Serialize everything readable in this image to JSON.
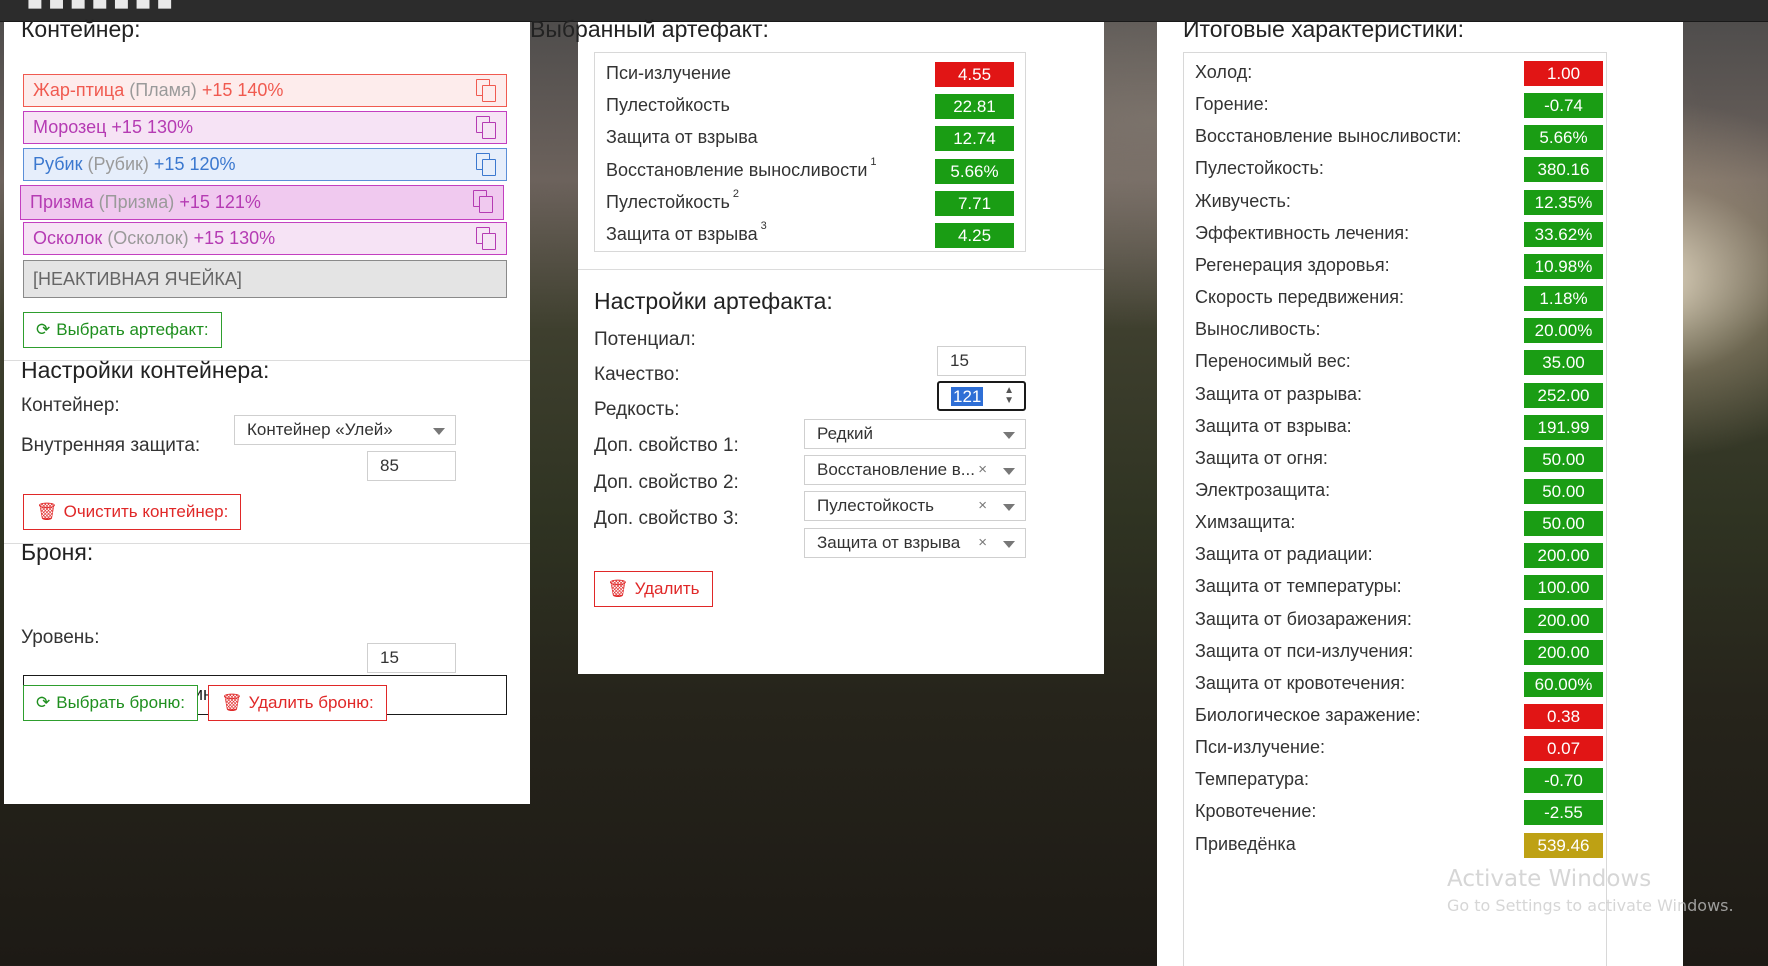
{
  "left": {
    "container_title": "Контейнер:",
    "slots": [
      {
        "name": "Жар-птица",
        "alt": "(Пламя)",
        "stat": "+15 140%",
        "color": "#f05a50",
        "border": "#f05a50",
        "bg": "#fdecec"
      },
      {
        "name": "Морозец",
        "alt": "",
        "stat": "+15 130%",
        "color": "#b53bb3",
        "border": "#c33fc0",
        "bg": "#f6e3f5"
      },
      {
        "name": "Рубик",
        "alt": "(Рубик)",
        "stat": "+15 120%",
        "color": "#3b78cf",
        "border": "#5b8fd8",
        "bg": "#e6eefb"
      },
      {
        "name": "Призма",
        "alt": "(Призма)",
        "stat": "+15 121%",
        "color": "#b53bb3",
        "border": "#c33fc0",
        "bg": "#f0c9ef"
      },
      {
        "name": "Осколок",
        "alt": "(Осколок)",
        "stat": "+15 130%",
        "color": "#b53bb3",
        "border": "#c33fc0",
        "bg": "#f6e3f5"
      }
    ],
    "inactive_slot": "[НЕАКТИВНАЯ ЯЧЕЙКА]",
    "choose_artifact_btn": "Выбрать артефакт:",
    "container_settings_title": "Настройки контейнера:",
    "container_label": "Контейнер:",
    "container_value": "Контейнер «Улей»",
    "inner_protection_label": "Внутренняя защита:",
    "inner_protection_value": "85",
    "clear_container_btn": "Очистить контейнер:",
    "armor_title": "Броня:",
    "armor_value": "Бронекостюм «Ронин»",
    "level_label": "Уровень:",
    "level_value": "15",
    "choose_armor_btn": "Выбрать броню:",
    "delete_armor_btn": "Удалить броню:"
  },
  "middle": {
    "selected_title": "Выбранный артефакт:",
    "stats": [
      {
        "name": "Пси-излучение",
        "sup": "",
        "value": "4.55",
        "type": "red"
      },
      {
        "name": "Пулестойкость",
        "sup": "",
        "value": "22.81",
        "type": "green"
      },
      {
        "name": "Защита от взрыва",
        "sup": "",
        "value": "12.74",
        "type": "green"
      },
      {
        "name": "Восстановление выносливости",
        "sup": "1",
        "value": "5.66%",
        "type": "green"
      },
      {
        "name": "Пулестойкость",
        "sup": "2",
        "value": "7.71",
        "type": "green"
      },
      {
        "name": "Защита от взрыва",
        "sup": "3",
        "value": "4.25",
        "type": "green"
      }
    ],
    "settings_title": "Настройки артефакта:",
    "potential_label": "Потенциал:",
    "potential_value": "15",
    "quality_label": "Качество:",
    "quality_value": "121",
    "rarity_label": "Редкость:",
    "rarity_value": "Редкий",
    "extra1_label": "Доп. свойство 1:",
    "extra1_value": "Восстановление в...",
    "extra2_label": "Доп. свойство 2:",
    "extra2_value": "Пулестойкость",
    "extra3_label": "Доп. свойство 3:",
    "extra3_value": "Защита от взрыва",
    "clear_symbol": "×",
    "delete_btn": "Удалить"
  },
  "right": {
    "title": "Итоговые характеристики:",
    "stats": [
      {
        "name": "Холод:",
        "value": "1.00",
        "type": "red"
      },
      {
        "name": "Горение:",
        "value": "-0.74",
        "type": "green"
      },
      {
        "name": "Восстановление выносливости:",
        "value": "5.66%",
        "type": "green"
      },
      {
        "name": "Пулестойкость:",
        "value": "380.16",
        "type": "green"
      },
      {
        "name": "Живучесть:",
        "value": "12.35%",
        "type": "green"
      },
      {
        "name": "Эффективность лечения:",
        "value": "33.62%",
        "type": "green"
      },
      {
        "name": "Регенерация здоровья:",
        "value": "10.98%",
        "type": "green"
      },
      {
        "name": "Скорость передвижения:",
        "value": "1.18%",
        "type": "green"
      },
      {
        "name": "Выносливость:",
        "value": "20.00%",
        "type": "green"
      },
      {
        "name": "Переносимый вес:",
        "value": "35.00",
        "type": "green"
      },
      {
        "name": "Защита от разрыва:",
        "value": "252.00",
        "type": "green"
      },
      {
        "name": "Защита от взрыва:",
        "value": "191.99",
        "type": "green"
      },
      {
        "name": "Защита от огня:",
        "value": "50.00",
        "type": "green"
      },
      {
        "name": "Электрозащита:",
        "value": "50.00",
        "type": "green"
      },
      {
        "name": "Химзащита:",
        "value": "50.00",
        "type": "green"
      },
      {
        "name": "Защита от радиации:",
        "value": "200.00",
        "type": "green"
      },
      {
        "name": "Защита от температуры:",
        "value": "100.00",
        "type": "green"
      },
      {
        "name": "Защита от биозаражения:",
        "value": "200.00",
        "type": "green"
      },
      {
        "name": "Защита от пси-излучения:",
        "value": "200.00",
        "type": "green"
      },
      {
        "name": "Защита от кровотечения:",
        "value": "60.00%",
        "type": "green"
      },
      {
        "name": "Биологическое заражение:",
        "value": "0.38",
        "type": "red"
      },
      {
        "name": "Пси-излучение:",
        "value": "0.07",
        "type": "red"
      },
      {
        "name": "Температура:",
        "value": "-0.70",
        "type": "green"
      },
      {
        "name": "Кровотечение:",
        "value": "-2.55",
        "type": "green"
      },
      {
        "name": "Приведёнка",
        "value": "539.46",
        "type": "gold"
      }
    ]
  },
  "watermark": {
    "line1": "Activate Windows",
    "line2": "Go to Settings to activate Windows."
  },
  "icons": {
    "copy": "copy-icon",
    "refresh": "refresh-icon",
    "trash": "trash-icon",
    "caret": "chevron-down-icon"
  },
  "colors": {
    "stat_red": "#e11515",
    "stat_green": "#1a9d14",
    "stat_gold": "#bea114",
    "button_green": "#2e9e2e",
    "button_red": "#e02828"
  }
}
